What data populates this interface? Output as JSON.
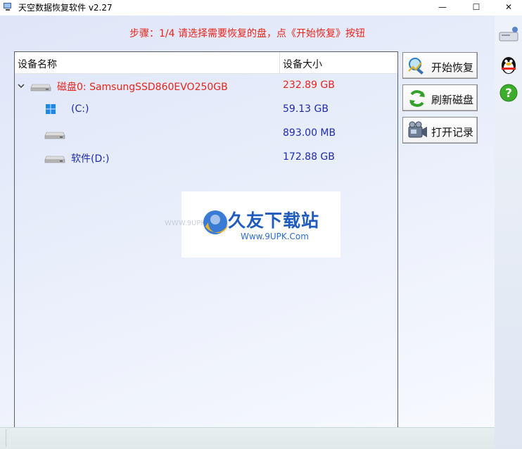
{
  "window": {
    "title": "天空数据恢复软件 v2.27",
    "controls": {
      "minimize": "—",
      "maximize": "☐",
      "close": "✕"
    }
  },
  "step_instruction": "步骤：1/4 请选择需要恢复的盘，点《开始恢复》按钮",
  "device_table": {
    "columns": {
      "name": "设备名称",
      "size": "设备大小"
    },
    "rows": [
      {
        "name": "磁盘0: SamsungSSD860EVO250GB",
        "size": "232.89 GB",
        "type": "disk",
        "level": 0,
        "expanded": true
      },
      {
        "name": "(C:)",
        "size": "59.13 GB",
        "type": "windows-partition",
        "level": 1
      },
      {
        "name": "",
        "size": "893.00 MB",
        "type": "partition",
        "level": 1
      },
      {
        "name": "软件(D:)",
        "size": "172.88 GB",
        "type": "partition",
        "level": 1
      }
    ]
  },
  "actions": {
    "start_recovery": "开始恢复",
    "refresh_disks": "刷新磁盘",
    "open_records": "打开记录"
  },
  "watermark": {
    "title": "久友下载站",
    "url": "Www.9UPK.Com",
    "small": "WWW.9UPK.COM"
  },
  "colors": {
    "accent_red": "#e8251c",
    "partition_blue": "#1d2bb0",
    "watermark_blue": "#1f5bbf"
  }
}
